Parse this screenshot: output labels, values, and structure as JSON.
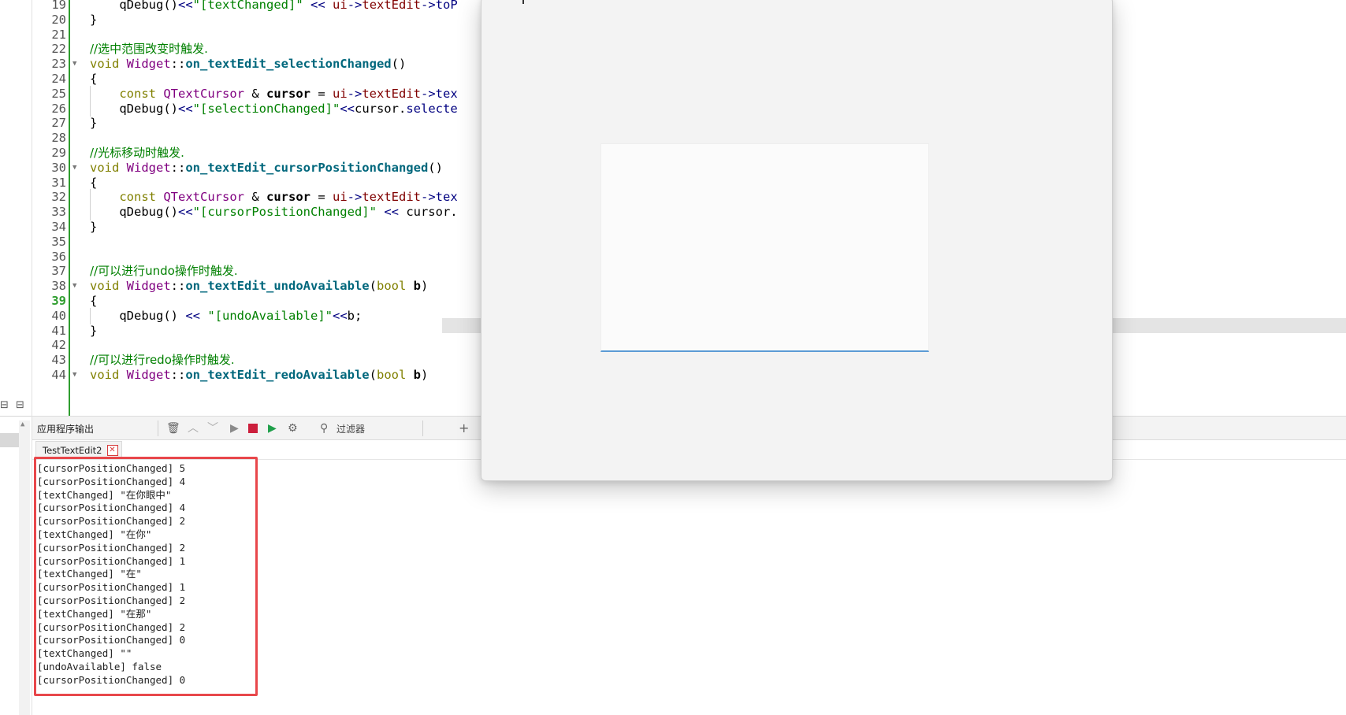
{
  "editor": {
    "lines": [
      {
        "num": "19",
        "tokens": [
          {
            "t": "    ",
            "c": "pl"
          },
          {
            "t": "qDebug",
            "c": "pl"
          },
          {
            "t": "()",
            "c": "pl"
          },
          {
            "t": "<<",
            "c": "op"
          },
          {
            "t": "\"[textChanged]\"",
            "c": "str"
          },
          {
            "t": " ",
            "c": "pl"
          },
          {
            "t": "<<",
            "c": "op"
          },
          {
            "t": " ",
            "c": "pl"
          },
          {
            "t": "ui",
            "c": "mem"
          },
          {
            "t": "->",
            "c": "op"
          },
          {
            "t": "textEdit",
            "c": "mem"
          },
          {
            "t": "->",
            "c": "op"
          },
          {
            "t": "toP",
            "c": "fn2"
          }
        ]
      },
      {
        "num": "20",
        "tokens": [
          {
            "t": "}",
            "c": "pl"
          }
        ]
      },
      {
        "num": "21",
        "tokens": []
      },
      {
        "num": "22",
        "tokens": [
          {
            "t": "//选中范围改变时触发.",
            "c": "com"
          }
        ]
      },
      {
        "num": "23",
        "fold": true,
        "tokens": [
          {
            "t": "void",
            "c": "kw"
          },
          {
            "t": " ",
            "c": "pl"
          },
          {
            "t": "Widget",
            "c": "cls"
          },
          {
            "t": "::",
            "c": "pl"
          },
          {
            "t": "on_textEdit_selectionChanged",
            "c": "fn"
          },
          {
            "t": "()",
            "c": "pl"
          }
        ]
      },
      {
        "num": "24",
        "tokens": [
          {
            "t": "{",
            "c": "pl"
          }
        ]
      },
      {
        "num": "25",
        "tokens": [
          {
            "t": "    ",
            "c": "pl"
          },
          {
            "t": "const",
            "c": "kw"
          },
          {
            "t": " ",
            "c": "pl"
          },
          {
            "t": "QTextCursor",
            "c": "cls"
          },
          {
            "t": " & ",
            "c": "pl"
          },
          {
            "t": "cursor",
            "c": "var"
          },
          {
            "t": " = ",
            "c": "pl"
          },
          {
            "t": "ui",
            "c": "mem"
          },
          {
            "t": "->",
            "c": "op"
          },
          {
            "t": "textEdit",
            "c": "mem"
          },
          {
            "t": "->",
            "c": "op"
          },
          {
            "t": "tex",
            "c": "fn2"
          }
        ]
      },
      {
        "num": "26",
        "tokens": [
          {
            "t": "    ",
            "c": "pl"
          },
          {
            "t": "qDebug",
            "c": "pl"
          },
          {
            "t": "()",
            "c": "pl"
          },
          {
            "t": "<<",
            "c": "op"
          },
          {
            "t": "\"[selectionChanged]\"",
            "c": "str"
          },
          {
            "t": "<<",
            "c": "op"
          },
          {
            "t": "cursor",
            "c": "pl"
          },
          {
            "t": ".",
            "c": "pl"
          },
          {
            "t": "selecte",
            "c": "fn2"
          }
        ]
      },
      {
        "num": "27",
        "tokens": [
          {
            "t": "}",
            "c": "pl"
          }
        ]
      },
      {
        "num": "28",
        "tokens": []
      },
      {
        "num": "29",
        "tokens": [
          {
            "t": "//光标移动时触发.",
            "c": "com"
          }
        ]
      },
      {
        "num": "30",
        "fold": true,
        "tokens": [
          {
            "t": "void",
            "c": "kw"
          },
          {
            "t": " ",
            "c": "pl"
          },
          {
            "t": "Widget",
            "c": "cls"
          },
          {
            "t": "::",
            "c": "pl"
          },
          {
            "t": "on_textEdit_cursorPositionChanged",
            "c": "fn"
          },
          {
            "t": "()",
            "c": "pl"
          }
        ]
      },
      {
        "num": "31",
        "tokens": [
          {
            "t": "{",
            "c": "pl"
          }
        ]
      },
      {
        "num": "32",
        "tokens": [
          {
            "t": "    ",
            "c": "pl"
          },
          {
            "t": "const",
            "c": "kw"
          },
          {
            "t": " ",
            "c": "pl"
          },
          {
            "t": "QTextCursor",
            "c": "cls"
          },
          {
            "t": " & ",
            "c": "pl"
          },
          {
            "t": "cursor",
            "c": "var"
          },
          {
            "t": " = ",
            "c": "pl"
          },
          {
            "t": "ui",
            "c": "mem"
          },
          {
            "t": "->",
            "c": "op"
          },
          {
            "t": "textEdit",
            "c": "mem"
          },
          {
            "t": "->",
            "c": "op"
          },
          {
            "t": "tex",
            "c": "fn2"
          }
        ]
      },
      {
        "num": "33",
        "tokens": [
          {
            "t": "    ",
            "c": "pl"
          },
          {
            "t": "qDebug",
            "c": "pl"
          },
          {
            "t": "()",
            "c": "pl"
          },
          {
            "t": "<<",
            "c": "op"
          },
          {
            "t": "\"[cursorPositionChanged]\"",
            "c": "str"
          },
          {
            "t": " ",
            "c": "pl"
          },
          {
            "t": "<<",
            "c": "op"
          },
          {
            "t": " cursor.",
            "c": "pl"
          }
        ]
      },
      {
        "num": "34",
        "tokens": [
          {
            "t": "}",
            "c": "pl"
          }
        ]
      },
      {
        "num": "35",
        "tokens": []
      },
      {
        "num": "36",
        "tokens": []
      },
      {
        "num": "37",
        "tokens": [
          {
            "t": "//可以进行undo操作时触发.",
            "c": "com"
          }
        ]
      },
      {
        "num": "38",
        "fold": true,
        "tokens": [
          {
            "t": "void",
            "c": "kw"
          },
          {
            "t": " ",
            "c": "pl"
          },
          {
            "t": "Widget",
            "c": "cls"
          },
          {
            "t": "::",
            "c": "pl"
          },
          {
            "t": "on_textEdit_undoAvailable",
            "c": "fn"
          },
          {
            "t": "(",
            "c": "pl"
          },
          {
            "t": "bool",
            "c": "kw"
          },
          {
            "t": " ",
            "c": "pl"
          },
          {
            "t": "b",
            "c": "var"
          },
          {
            "t": ")",
            "c": "pl"
          }
        ]
      },
      {
        "num": "39",
        "current": true,
        "tokens": [
          {
            "t": "{",
            "c": "pl"
          }
        ]
      },
      {
        "num": "40",
        "tokens": [
          {
            "t": "    ",
            "c": "pl"
          },
          {
            "t": "qDebug",
            "c": "pl"
          },
          {
            "t": "()",
            "c": "pl"
          },
          {
            "t": " ",
            "c": "pl"
          },
          {
            "t": "<<",
            "c": "op"
          },
          {
            "t": " ",
            "c": "pl"
          },
          {
            "t": "\"[undoAvailable]\"",
            "c": "str"
          },
          {
            "t": "<<",
            "c": "op"
          },
          {
            "t": "b;",
            "c": "pl"
          }
        ]
      },
      {
        "num": "41",
        "tokens": [
          {
            "t": "}",
            "c": "pl"
          }
        ]
      },
      {
        "num": "42",
        "tokens": []
      },
      {
        "num": "43",
        "tokens": [
          {
            "t": "//可以进行redo操作时触发.",
            "c": "com"
          }
        ]
      },
      {
        "num": "44",
        "fold": true,
        "tokens": [
          {
            "t": "void",
            "c": "kw"
          },
          {
            "t": " ",
            "c": "pl"
          },
          {
            "t": "Widget",
            "c": "cls"
          },
          {
            "t": "::",
            "c": "pl"
          },
          {
            "t": "on_textEdit_redoAvailable",
            "c": "fn"
          },
          {
            "t": "(",
            "c": "pl"
          },
          {
            "t": "bool",
            "c": "kw"
          },
          {
            "t": " ",
            "c": "pl"
          },
          {
            "t": "b",
            "c": "var"
          },
          {
            "t": ")",
            "c": "pl"
          }
        ]
      }
    ]
  },
  "output": {
    "pane_title": "应用程序输出",
    "filter_label": "过滤器",
    "tab_label": "TestTextEdit2",
    "log_lines": [
      "[cursorPositionChanged] 5",
      "[cursorPositionChanged] 4",
      "[textChanged] \"在你眼中\"",
      "[cursorPositionChanged] 4",
      "[cursorPositionChanged] 2",
      "[textChanged] \"在你\"",
      "[cursorPositionChanged] 2",
      "[cursorPositionChanged] 1",
      "[textChanged] \"在\"",
      "[cursorPositionChanged] 1",
      "[cursorPositionChanged] 2",
      "[textChanged] \"在那\"",
      "[cursorPositionChanged] 2",
      "[cursorPositionChanged] 0",
      "[textChanged] \"\"",
      "[undoAvailable] false",
      "[cursorPositionChanged] 0"
    ]
  },
  "icons": {
    "trash": "trash-icon",
    "up": "arrow-up-icon",
    "down": "arrow-down-icon",
    "run": "run-icon",
    "stop": "stop-icon",
    "debug": "debug-run-icon",
    "settings": "gear-icon",
    "filter": "search-icon",
    "add": "plus-icon"
  },
  "colors": {
    "highlight_box": "#e8474b",
    "gutter_bar": "#2e9d2e",
    "textedit_focus": "#5b9bd5",
    "stop_button": "#cc1f3c"
  }
}
